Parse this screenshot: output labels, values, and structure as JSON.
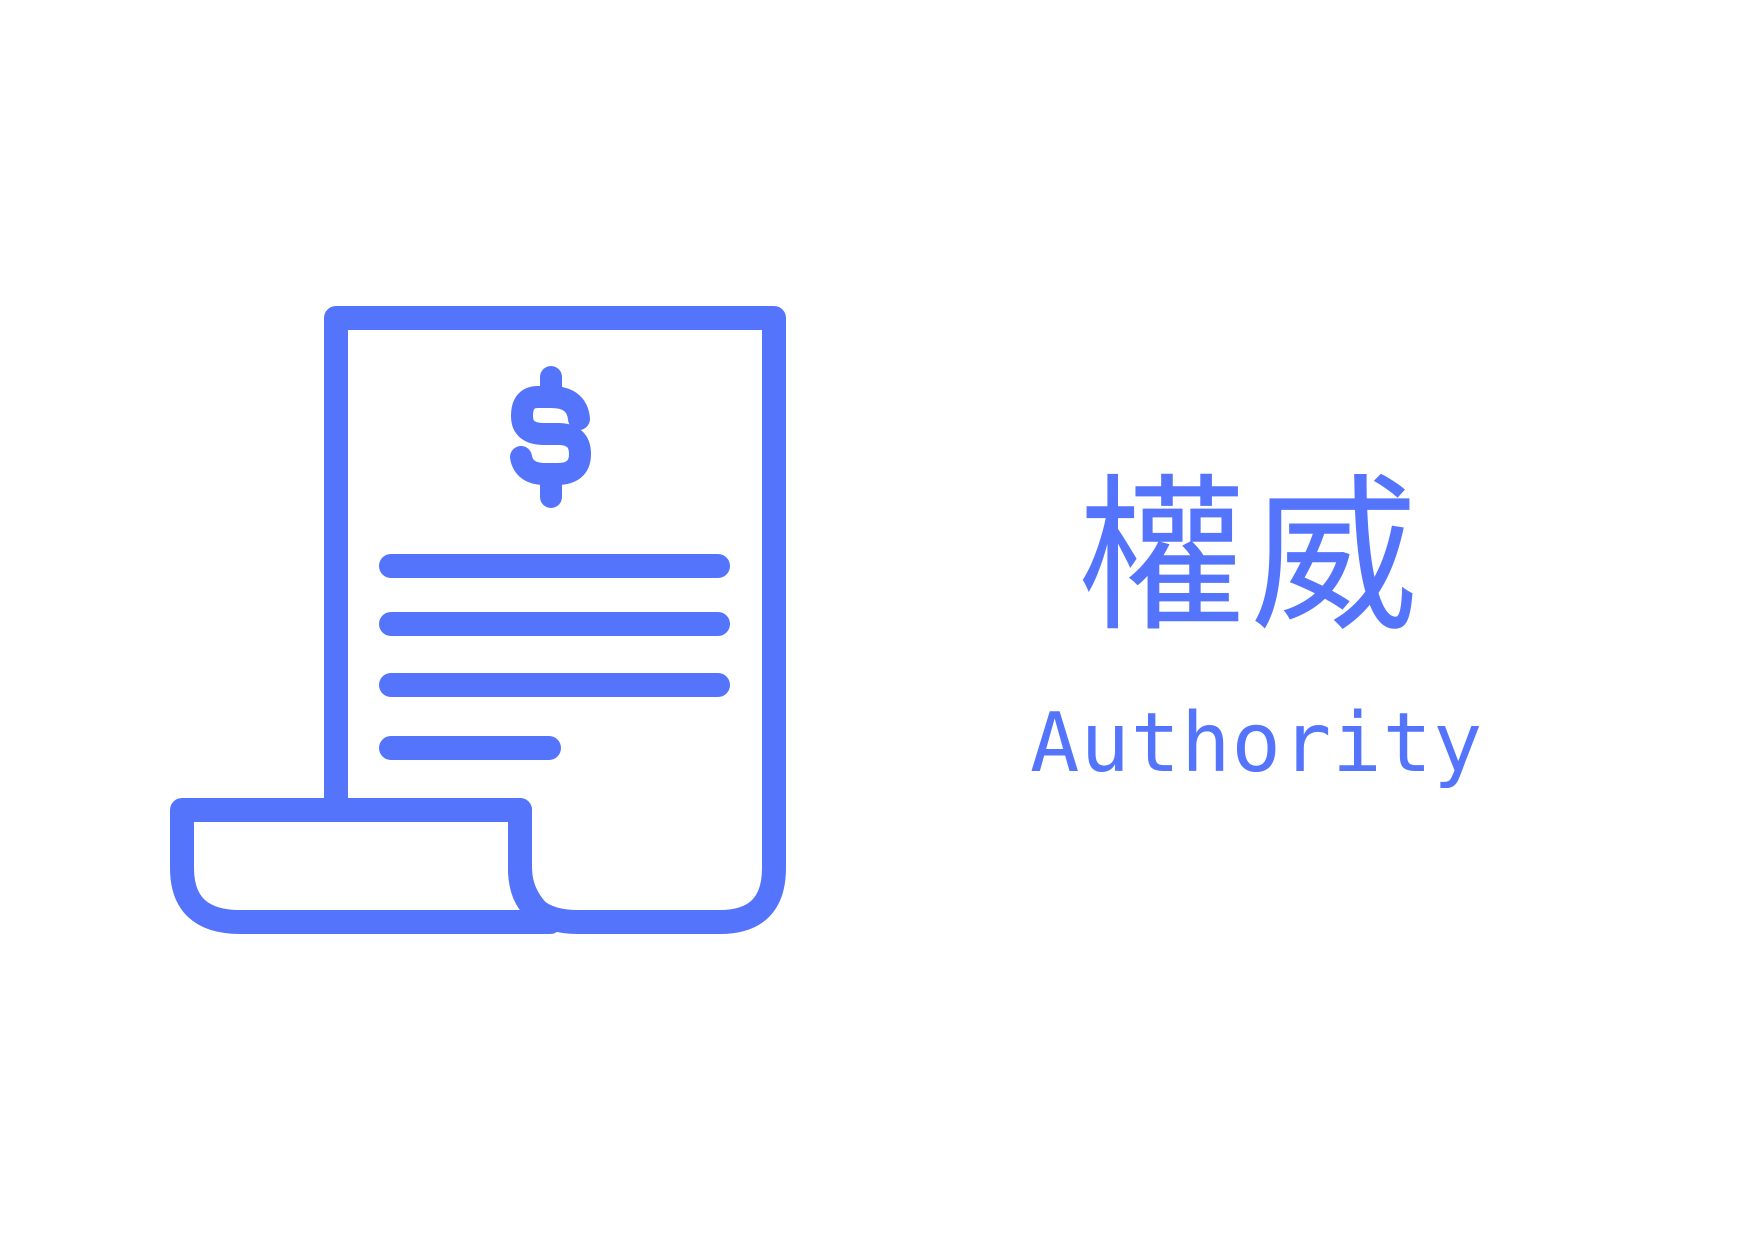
{
  "label": {
    "chinese": "權威",
    "english": "Authority"
  },
  "icon": {
    "name": "receipt-dollar-icon"
  },
  "colors": {
    "accent": "#5474fc",
    "background": "#ffffff"
  }
}
